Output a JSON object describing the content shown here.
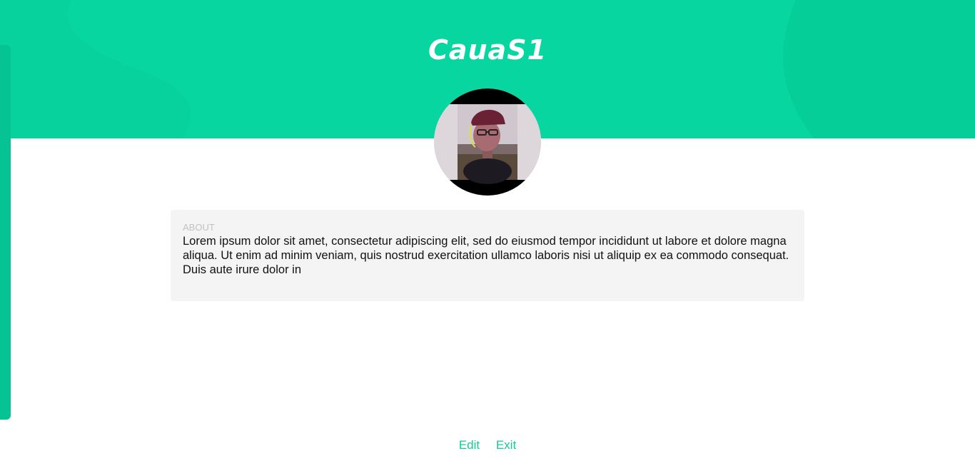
{
  "profile": {
    "username": "CauaS1",
    "avatar_alt": "profile photo"
  },
  "about": {
    "label": "ABOUT",
    "text": "Lorem ipsum dolor sit amet, consectetur adipiscing elit, sed do eiusmod tempor incididunt ut labore et dolore magna aliqua. Ut enim ad minim veniam, quis nostrud exercitation ullamco laboris nisi ut aliquip ex ea commodo consequat. Duis aute irure dolor in"
  },
  "actions": {
    "edit_label": "Edit",
    "exit_label": "Exit"
  },
  "colors": {
    "header": "#08d6a0",
    "accent": "#14c99a",
    "card": "#f4f4f4"
  }
}
